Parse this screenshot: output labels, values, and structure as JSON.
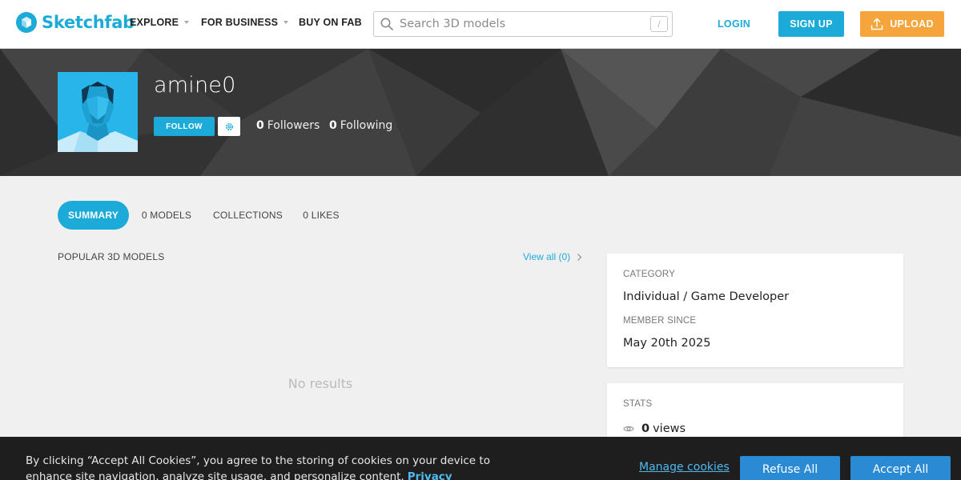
{
  "brand": {
    "name": "Sketchfab",
    "color": "#1caad9"
  },
  "nav": {
    "explore": "EXPLORE",
    "for_business": "FOR BUSINESS",
    "buy_on_fab": "BUY ON FAB",
    "search_placeholder": "Search 3D models",
    "search_shortcut": "/",
    "login": "LOGIN",
    "signup": "SIGN UP",
    "upload": "UPLOAD"
  },
  "profile": {
    "username": "amine0",
    "follow_label": "FOLLOW",
    "followers_count": "0",
    "followers_label": "Followers",
    "following_count": "0",
    "following_label": "Following"
  },
  "tabs": [
    {
      "label": "SUMMARY",
      "active": true
    },
    {
      "label": "0 MODELS",
      "active": false
    },
    {
      "label": "COLLECTIONS",
      "active": false
    },
    {
      "label": "0 LIKES",
      "active": false
    }
  ],
  "popular": {
    "title": "POPULAR 3D MODELS",
    "view_all": "View all (0)",
    "empty": "No results"
  },
  "info_card": {
    "category_label": "CATEGORY",
    "category_value": "Individual / Game Developer",
    "member_since_label": "MEMBER SINCE",
    "member_since_value": "May 20th 2025"
  },
  "stats_card": {
    "label": "STATS",
    "views_count": "0",
    "views_label": "views"
  },
  "cookie": {
    "text": "By clicking “Accept All Cookies”, you agree to the storing of cookies on your device to enhance site navigation, analyze site usage, and personalize content.",
    "privacy_link": "Privacy Policy",
    "manage": "Manage cookies",
    "refuse": "Refuse All",
    "accept": "Accept All"
  },
  "colors": {
    "accent": "#1caad9",
    "upload": "#f6a53c",
    "banner": "#3a3a3a",
    "cookie_bg": "#1e1e1e",
    "cookie_button": "#2a8bd4"
  }
}
